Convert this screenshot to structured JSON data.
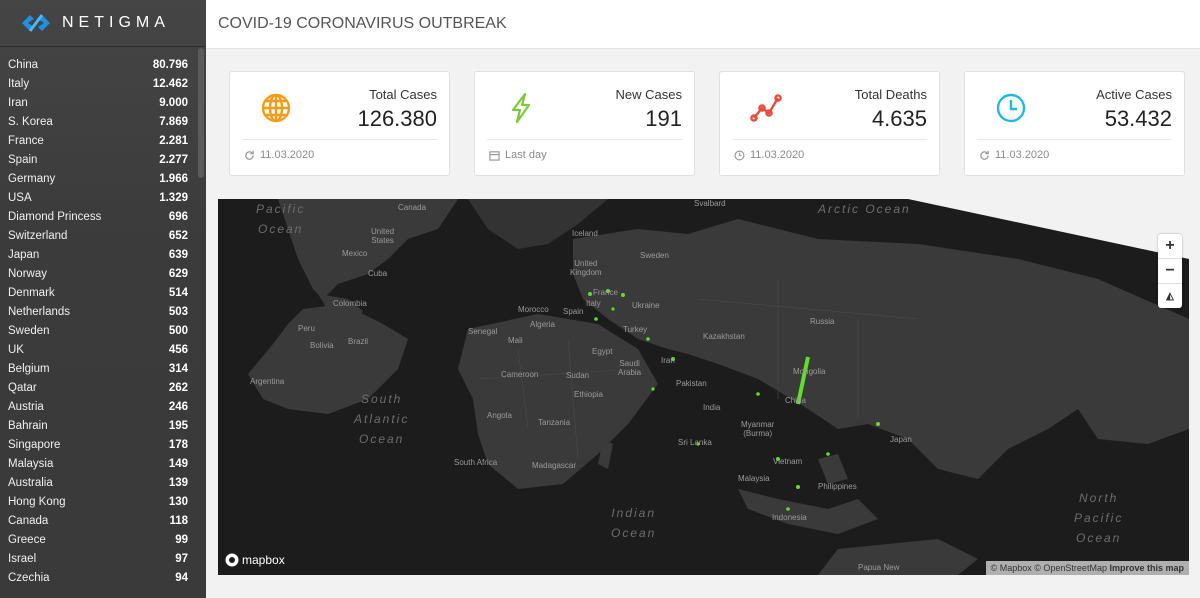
{
  "brand": {
    "name": "NETIGMA"
  },
  "header": {
    "title": "COVID-19 CORONAVIRUS OUTBREAK"
  },
  "countries": [
    {
      "name": "China",
      "count": "80.796"
    },
    {
      "name": "Italy",
      "count": "12.462"
    },
    {
      "name": "Iran",
      "count": "9.000"
    },
    {
      "name": "S. Korea",
      "count": "7.869"
    },
    {
      "name": "France",
      "count": "2.281"
    },
    {
      "name": "Spain",
      "count": "2.277"
    },
    {
      "name": "Germany",
      "count": "1.966"
    },
    {
      "name": "USA",
      "count": "1.329"
    },
    {
      "name": "Diamond Princess",
      "count": "696"
    },
    {
      "name": "Switzerland",
      "count": "652"
    },
    {
      "name": "Japan",
      "count": "639"
    },
    {
      "name": "Norway",
      "count": "629"
    },
    {
      "name": "Denmark",
      "count": "514"
    },
    {
      "name": "Netherlands",
      "count": "503"
    },
    {
      "name": "Sweden",
      "count": "500"
    },
    {
      "name": "UK",
      "count": "456"
    },
    {
      "name": "Belgium",
      "count": "314"
    },
    {
      "name": "Qatar",
      "count": "262"
    },
    {
      "name": "Austria",
      "count": "246"
    },
    {
      "name": "Bahrain",
      "count": "195"
    },
    {
      "name": "Singapore",
      "count": "178"
    },
    {
      "name": "Malaysia",
      "count": "149"
    },
    {
      "name": "Australia",
      "count": "139"
    },
    {
      "name": "Hong Kong",
      "count": "130"
    },
    {
      "name": "Canada",
      "count": "118"
    },
    {
      "name": "Greece",
      "count": "99"
    },
    {
      "name": "Israel",
      "count": "97"
    },
    {
      "name": "Czechia",
      "count": "94"
    }
  ],
  "cards": [
    {
      "label": "Total Cases",
      "value": "126.380",
      "footer": "11.03.2020",
      "icon": "globe-icon",
      "color": "#f39c12"
    },
    {
      "label": "New Cases",
      "value": "191",
      "footer": "Last day",
      "icon": "lightning-icon",
      "color": "#7cc73a"
    },
    {
      "label": "Total Deaths",
      "value": "4.635",
      "footer": "11.03.2020",
      "icon": "line-chart-icon",
      "color": "#e74c3c"
    },
    {
      "label": "Active Cases",
      "value": "53.432",
      "footer": "11.03.2020",
      "icon": "clock-icon",
      "color": "#1fb8e0"
    }
  ],
  "map": {
    "labels": {
      "canada": "Canada",
      "svalbard": "Svalbard",
      "united_states": "United\nStates",
      "mexico": "Mexico",
      "cuba": "Cuba",
      "colombia": "Colombia",
      "peru": "Peru",
      "bolivia": "Bolivia",
      "brazil": "Brazil",
      "argentina": "Argentina",
      "iceland": "Iceland",
      "uk": "United\nKingdom",
      "sweden": "Sweden",
      "france": "France",
      "ukraine": "Ukraine",
      "spain": "Spain",
      "italy": "Italy",
      "morocco": "Morocco",
      "algeria": "Algeria",
      "senegal": "Senegal",
      "mali": "Mali",
      "egypt": "Egypt",
      "turkey": "Turkey",
      "iran": "Iran",
      "saudi_arabia": "Saudi\nArabia",
      "kazakhstan": "Kazakhstan",
      "russia": "Russia",
      "mongolia": "Mongolia",
      "china": "China",
      "pakistan": "Pakistan",
      "india": "India",
      "sri_lanka": "Sri Lanka",
      "myanmar": "Myanmar\n(Burma)",
      "vietnam": "Vietnam",
      "philippines": "Philippines",
      "malaysia": "Malaysia",
      "indonesia": "Indonesia",
      "japan": "Japan",
      "papua": "Papua New",
      "cameroon": "Cameroon",
      "sudan": "Sudan",
      "ethiopia": "Ethiopia",
      "tanzania": "Tanzania",
      "angola": "Angola",
      "south_africa": "South Africa",
      "madagascar": "Madagascar"
    },
    "oceans": {
      "pacific_nw": "Pacific\nOcean",
      "arctic_ne": "Arctic Ocean",
      "south_atlantic": "South\nAtlantic\nOcean",
      "indian": "Indian\nOcean",
      "north_pacific": "North\nPacific\nOcean"
    },
    "zoom_in": "+",
    "zoom_out": "−",
    "compass": "◭",
    "mapbox_logo": "mapbox",
    "attribution": {
      "mapbox": "© Mapbox",
      "osm": "© OpenStreetMap",
      "improve": "Improve this map"
    }
  }
}
